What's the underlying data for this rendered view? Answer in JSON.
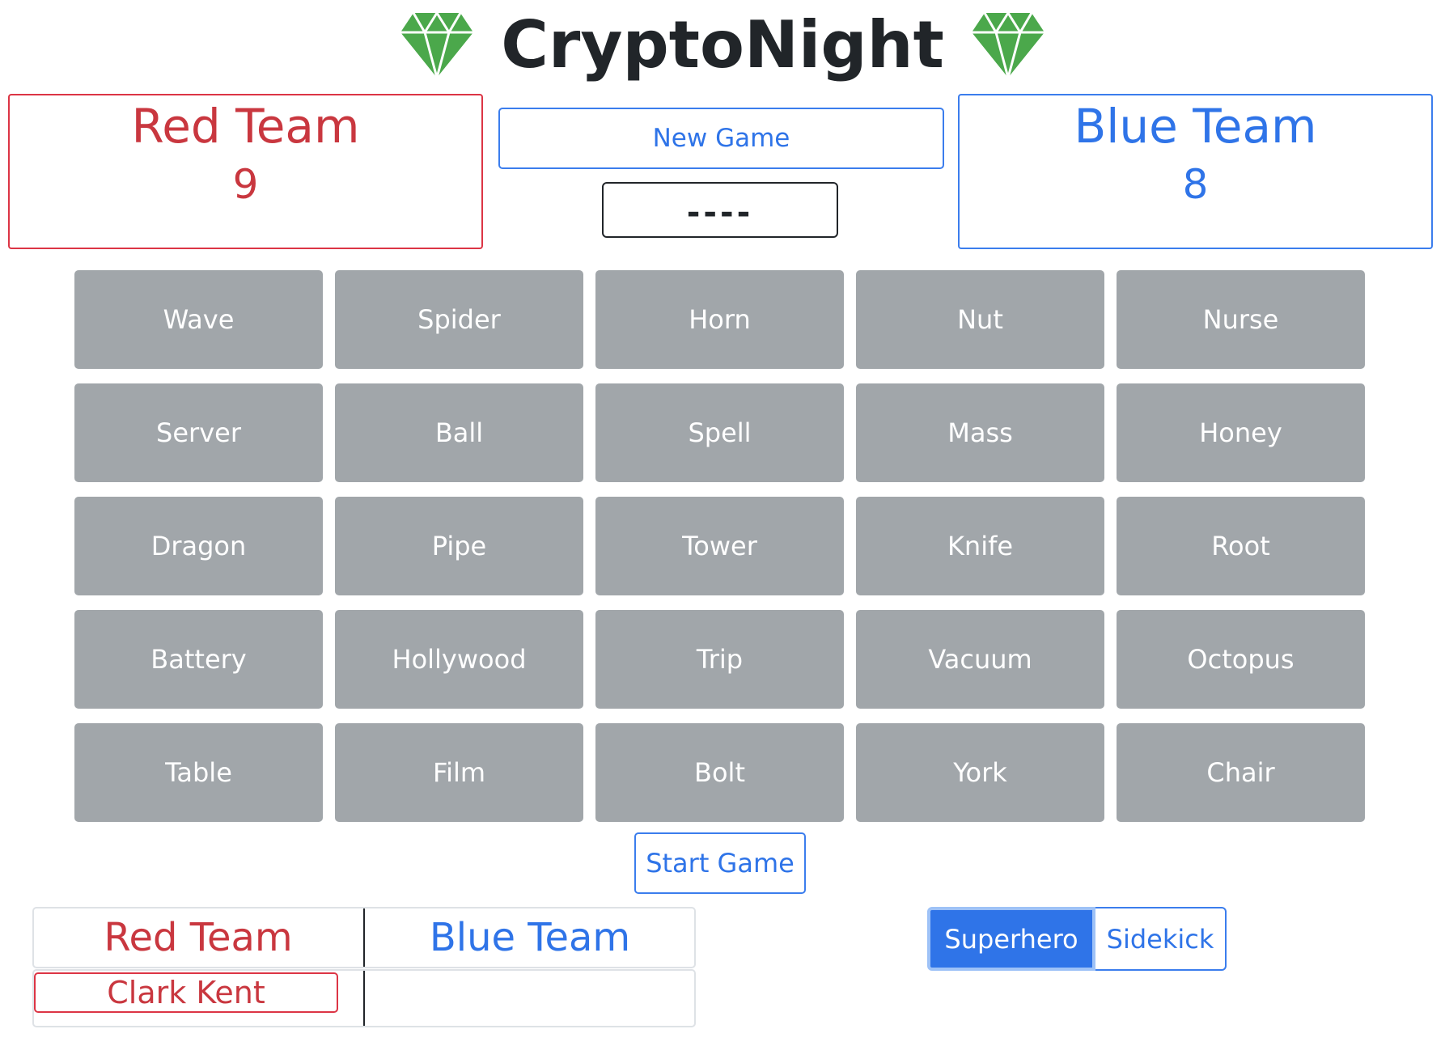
{
  "app": {
    "title": "CryptoNight",
    "gem_color": "#4ba84b",
    "gem_icon": "gem-icon"
  },
  "scoreboard": {
    "red": {
      "name": "Red Team",
      "score": "9",
      "color": "#dc3545"
    },
    "blue": {
      "name": "Blue Team",
      "score": "8",
      "color": "#3b7ded"
    }
  },
  "controls": {
    "new_game_label": "New Game",
    "code_display": "----",
    "start_game_label": "Start Game"
  },
  "board": {
    "card_color": "#a1a6aa",
    "rows": [
      [
        "Wave",
        "Spider",
        "Horn",
        "Nut",
        "Nurse"
      ],
      [
        "Server",
        "Ball",
        "Spell",
        "Mass",
        "Honey"
      ],
      [
        "Dragon",
        "Pipe",
        "Tower",
        "Knife",
        "Root"
      ],
      [
        "Battery",
        "Hollywood",
        "Trip",
        "Vacuum",
        "Octopus"
      ],
      [
        "Table",
        "Film",
        "Bolt",
        "York",
        "Chair"
      ]
    ]
  },
  "roster": {
    "red_header": "Red Team",
    "blue_header": "Blue Team",
    "red_players": [
      "Clark Kent"
    ],
    "blue_players": []
  },
  "roles": {
    "options": [
      "Superhero",
      "Sidekick"
    ],
    "selected": "Superhero"
  }
}
